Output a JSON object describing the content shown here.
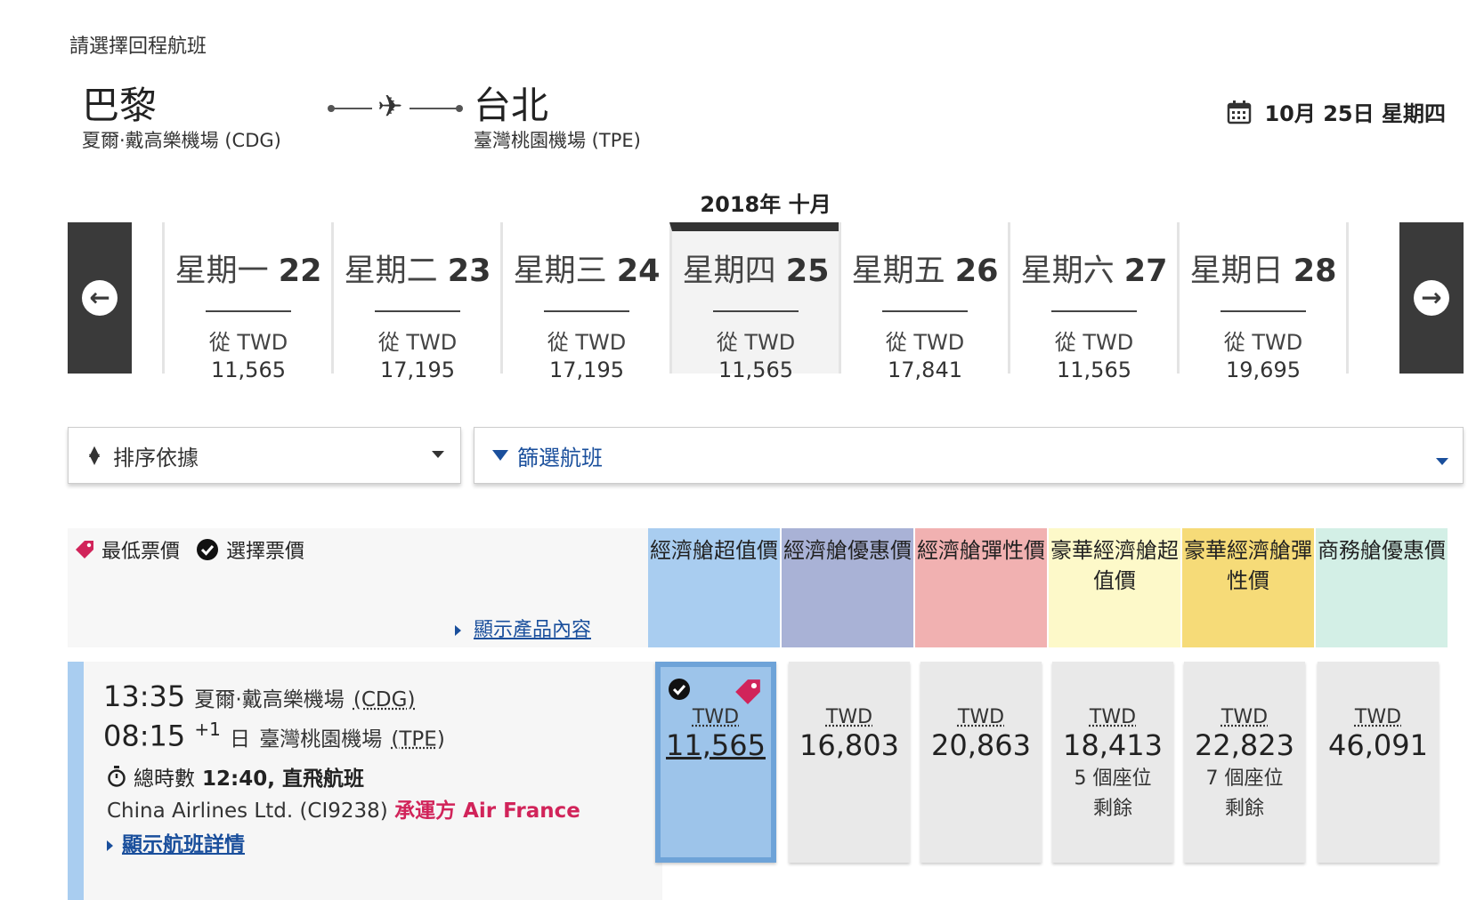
{
  "page_title": "請選擇回程航班",
  "route": {
    "origin_city": "巴黎",
    "origin_airport": "夏爾·戴高樂機場 (CDG)",
    "destination_city": "台北",
    "destination_airport": "臺灣桃園機場 (TPE)",
    "plane_icon": "✈"
  },
  "selected_date": "10月 25日 星期四",
  "month_label": "2018年 十月",
  "days": [
    {
      "name": "星期一",
      "num": "22",
      "from": "從 TWD",
      "price": "11,565"
    },
    {
      "name": "星期二",
      "num": "23",
      "from": "從 TWD",
      "price": "17,195"
    },
    {
      "name": "星期三",
      "num": "24",
      "from": "從 TWD",
      "price": "17,195"
    },
    {
      "name": "星期四",
      "num": "25",
      "from": "從 TWD",
      "price": "11,565"
    },
    {
      "name": "星期五",
      "num": "26",
      "from": "從 TWD",
      "price": "17,841"
    },
    {
      "name": "星期六",
      "num": "27",
      "from": "從 TWD",
      "price": "11,565"
    },
    {
      "name": "星期日",
      "num": "28",
      "from": "從 TWD",
      "price": "19,695"
    }
  ],
  "sort_label": "排序依據",
  "filter_label": "篩選航班",
  "legend": {
    "lowest": "最低票價",
    "selected": "選擇票價",
    "show_content": "顯示產品內容"
  },
  "cabins": [
    {
      "label": "經濟艙超值價",
      "color": "#a9cdf0"
    },
    {
      "label": "經濟艙優惠價",
      "color": "#a9b2d6"
    },
    {
      "label": "經濟艙彈性價",
      "color": "#f1b1b1"
    },
    {
      "label": "豪華經濟艙超值價",
      "color": "#fdf9c9"
    },
    {
      "label": "豪華經濟艙彈性價",
      "color": "#f6db78"
    },
    {
      "label": "商務艙優惠價",
      "color": "#d3efe6"
    }
  ],
  "flight": {
    "dep_time": "13:35",
    "dep_airport": "夏爾·戴高樂機場",
    "dep_code": "(CDG)",
    "arr_time": "08:15",
    "arr_plus": "+1",
    "arr_day": "日",
    "arr_airport": "臺灣桃園機場",
    "arr_code": "(TPE)",
    "duration_label": "總時數",
    "duration_value": "12:40, 直飛航班",
    "airline": "China Airlines Ltd. (CI9238)",
    "operated_by": "承運方 Air France",
    "details_link": "顯示航班詳情"
  },
  "fares": [
    {
      "currency": "TWD",
      "amount": "11,565",
      "seats1": "",
      "seats2": ""
    },
    {
      "currency": "TWD",
      "amount": "16,803",
      "seats1": "",
      "seats2": ""
    },
    {
      "currency": "TWD",
      "amount": "20,863",
      "seats1": "",
      "seats2": ""
    },
    {
      "currency": "TWD",
      "amount": "18,413",
      "seats1": "5 個座位",
      "seats2": "剩餘"
    },
    {
      "currency": "TWD",
      "amount": "22,823",
      "seats1": "7 個座位",
      "seats2": "剩餘"
    },
    {
      "currency": "TWD",
      "amount": "46,091",
      "seats1": "",
      "seats2": ""
    }
  ],
  "colors": {
    "accent": "#1a4f9c",
    "operator": "#d1245a",
    "tag": "#d1245a"
  }
}
